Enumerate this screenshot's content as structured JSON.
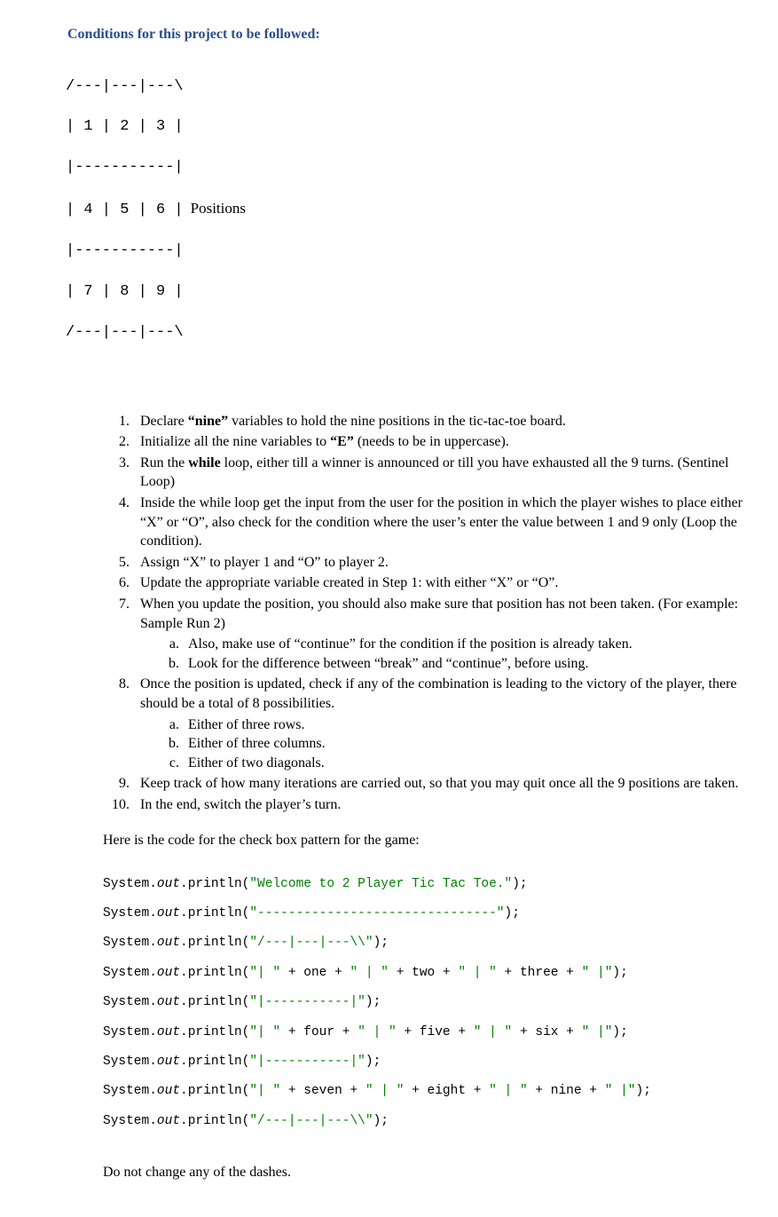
{
  "heading": "Conditions for this project to be followed:",
  "ascii": {
    "top": "/---|---|---\\",
    "row1": "| 1 | 2 | 3 |",
    "sep1": "|-----------|",
    "row2": "| 4 | 5 | 6 |",
    "sep2": "|-----------|",
    "row3": "| 7 | 8 | 9 |",
    "bottom": "/---|---|---\\",
    "positions_label": "Positions"
  },
  "list": {
    "i1a": "Declare ",
    "i1b": "“nine”",
    "i1c": " variables to hold the nine positions in the tic-tac-toe board.",
    "i2a": "Initialize all the nine variables to ",
    "i2b": "“E”",
    "i2c": " (needs to be in uppercase).",
    "i3a": "Run the ",
    "i3b": "while",
    "i3c": " loop, either till a winner is announced or till you have exhausted all the 9 turns. (Sentinel Loop)",
    "i4": "Inside the while loop get the input from the user for the position in which the player wishes to place either “X” or “O”, also check for the condition where the user’s enter the value between 1 and 9 only (Loop the condition).",
    "i5": "Assign “X” to player 1 and “O” to player 2.",
    "i6": "Update the appropriate variable created in Step 1: with either “X” or “O”.",
    "i7": "When you update the position, you should also make sure that position has not been taken. (For example: Sample Run 2)",
    "i7a": "Also, make use of “continue” for the condition if the position is already taken.",
    "i7b": "Look for the difference between “break” and “continue”, before using.",
    "i8": "Once the position is updated, check if any of the combination is leading to the victory of the player, there should be a total of 8 possibilities.",
    "i8a": "Either of three rows.",
    "i8b": "Either of three columns.",
    "i8c": "Either of two diagonals.",
    "i9": "Keep track of how many iterations are carried out, so that you may quit once all the 9 positions are taken.",
    "i10": "In the end, switch the player’s turn."
  },
  "code_intro": "Here is the code for the check box pattern for the game:",
  "code": {
    "sys": "System.",
    "out": "out",
    "println": ".println(",
    "close_stmt": ");",
    "s_welcome": "\"Welcome to 2 Player Tic Tac Toe.\"",
    "s_dashline": "\"-------------------------------\"",
    "s_top": "\"/---|---|---\\\\\"",
    "s_row_open": "\"| \"",
    "s_mid": "\" | \"",
    "s_end": "\" |\"",
    "s_sep": "\"|-----------|\"",
    "v1": "one",
    "v2": "two",
    "v3": "three",
    "v4": "four",
    "v5": "five",
    "v6": "six",
    "v7": "seven",
    "v8": "eight",
    "v9": "nine",
    "plus": " + "
  },
  "dash_note": "Do not change any of the dashes."
}
